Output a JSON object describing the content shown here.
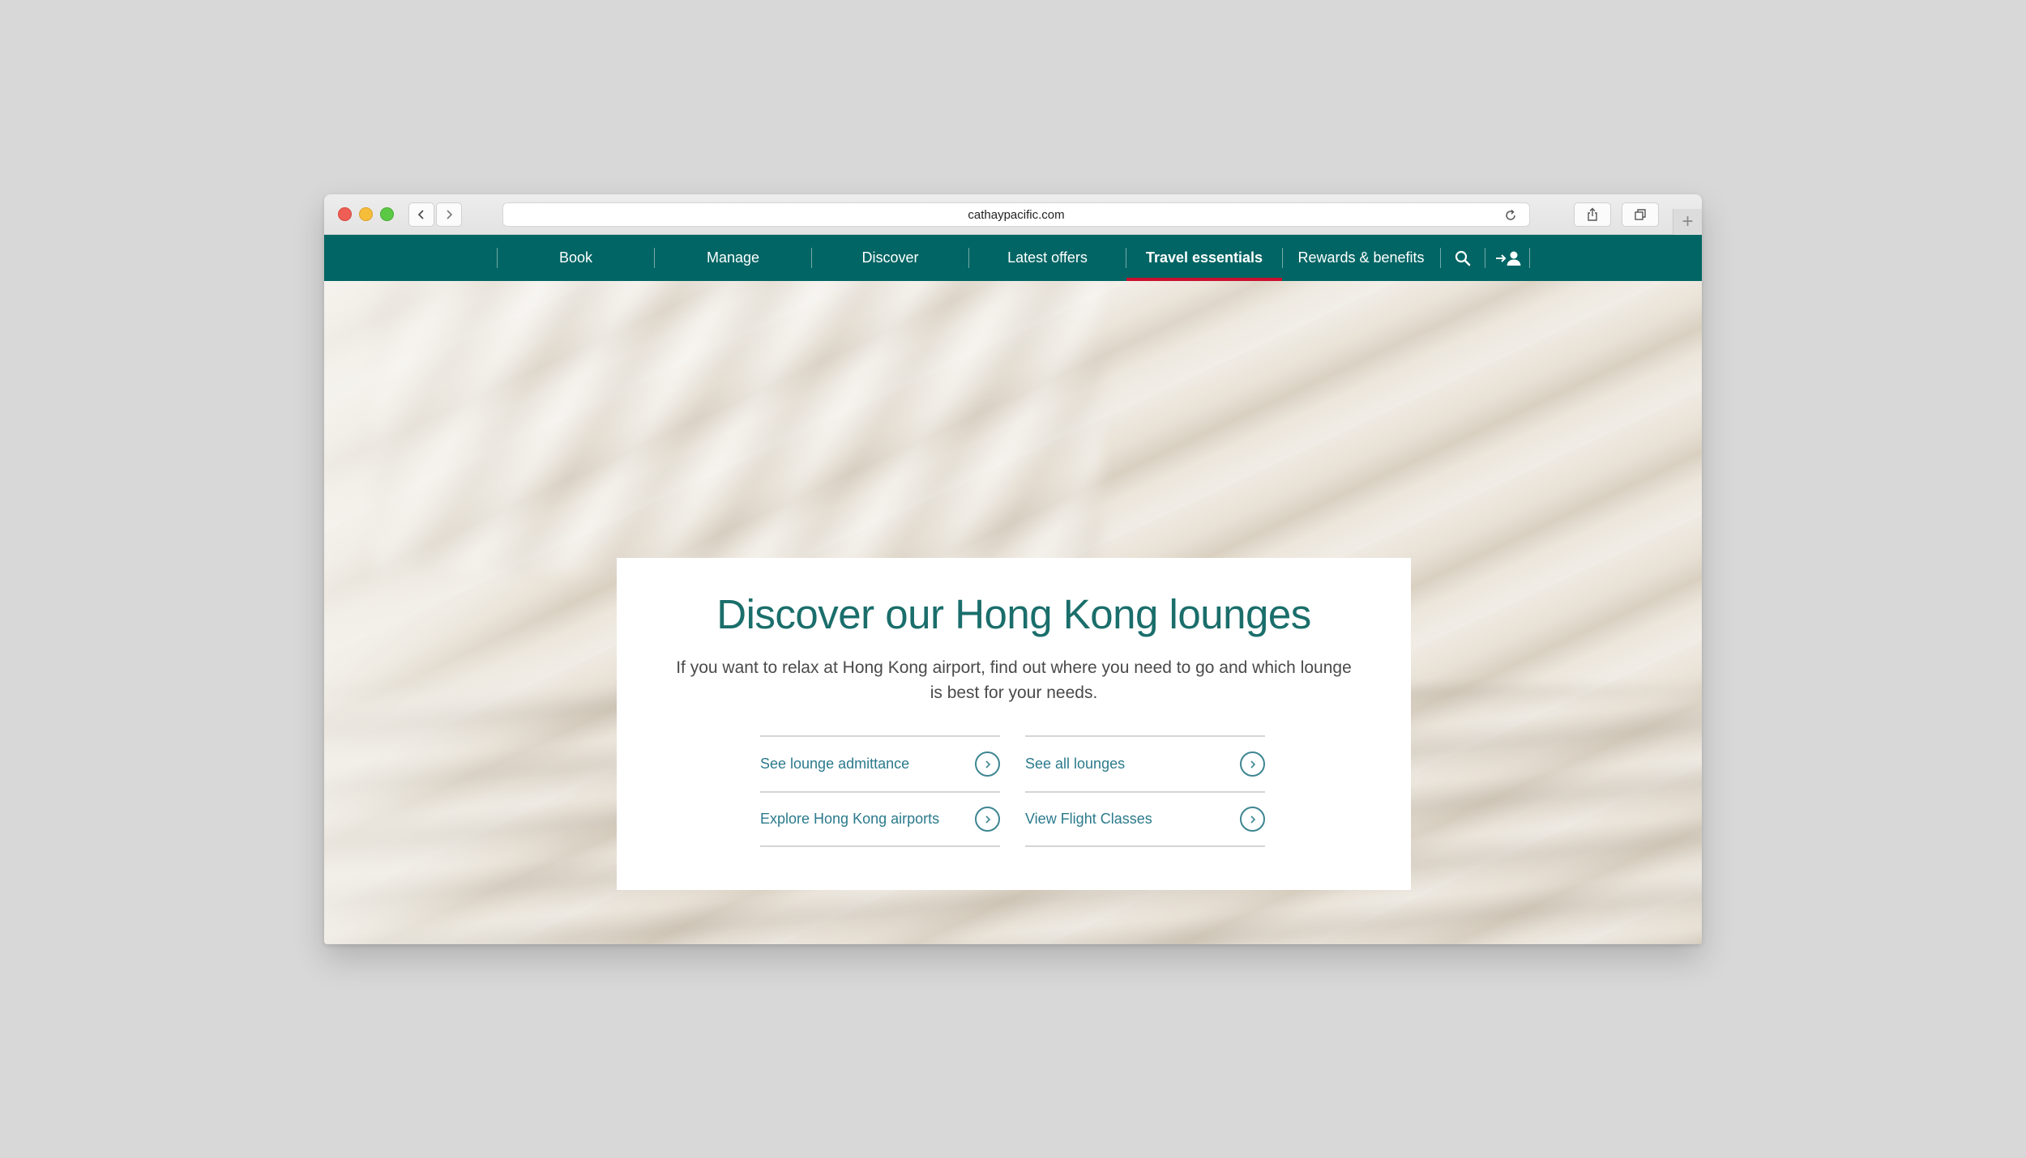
{
  "browser": {
    "url": "cathaypacific.com"
  },
  "nav": {
    "items": [
      {
        "label": "Book"
      },
      {
        "label": "Manage"
      },
      {
        "label": "Discover"
      },
      {
        "label": "Latest offers"
      },
      {
        "label": "Travel essentials"
      },
      {
        "label": "Rewards & benefits"
      }
    ],
    "active": "Travel essentials",
    "brand_color": "#006564",
    "active_indicator_color": "#c8102e"
  },
  "card": {
    "title": "Discover our Hong Kong lounges",
    "description": "If you want to relax at Hong Kong airport, find out where you need to go and which lounge is best for your needs.",
    "links": [
      {
        "label": "See lounge admittance"
      },
      {
        "label": "See all lounges"
      },
      {
        "label": "Explore Hong Kong airports"
      },
      {
        "label": "View Flight Classes"
      }
    ]
  }
}
